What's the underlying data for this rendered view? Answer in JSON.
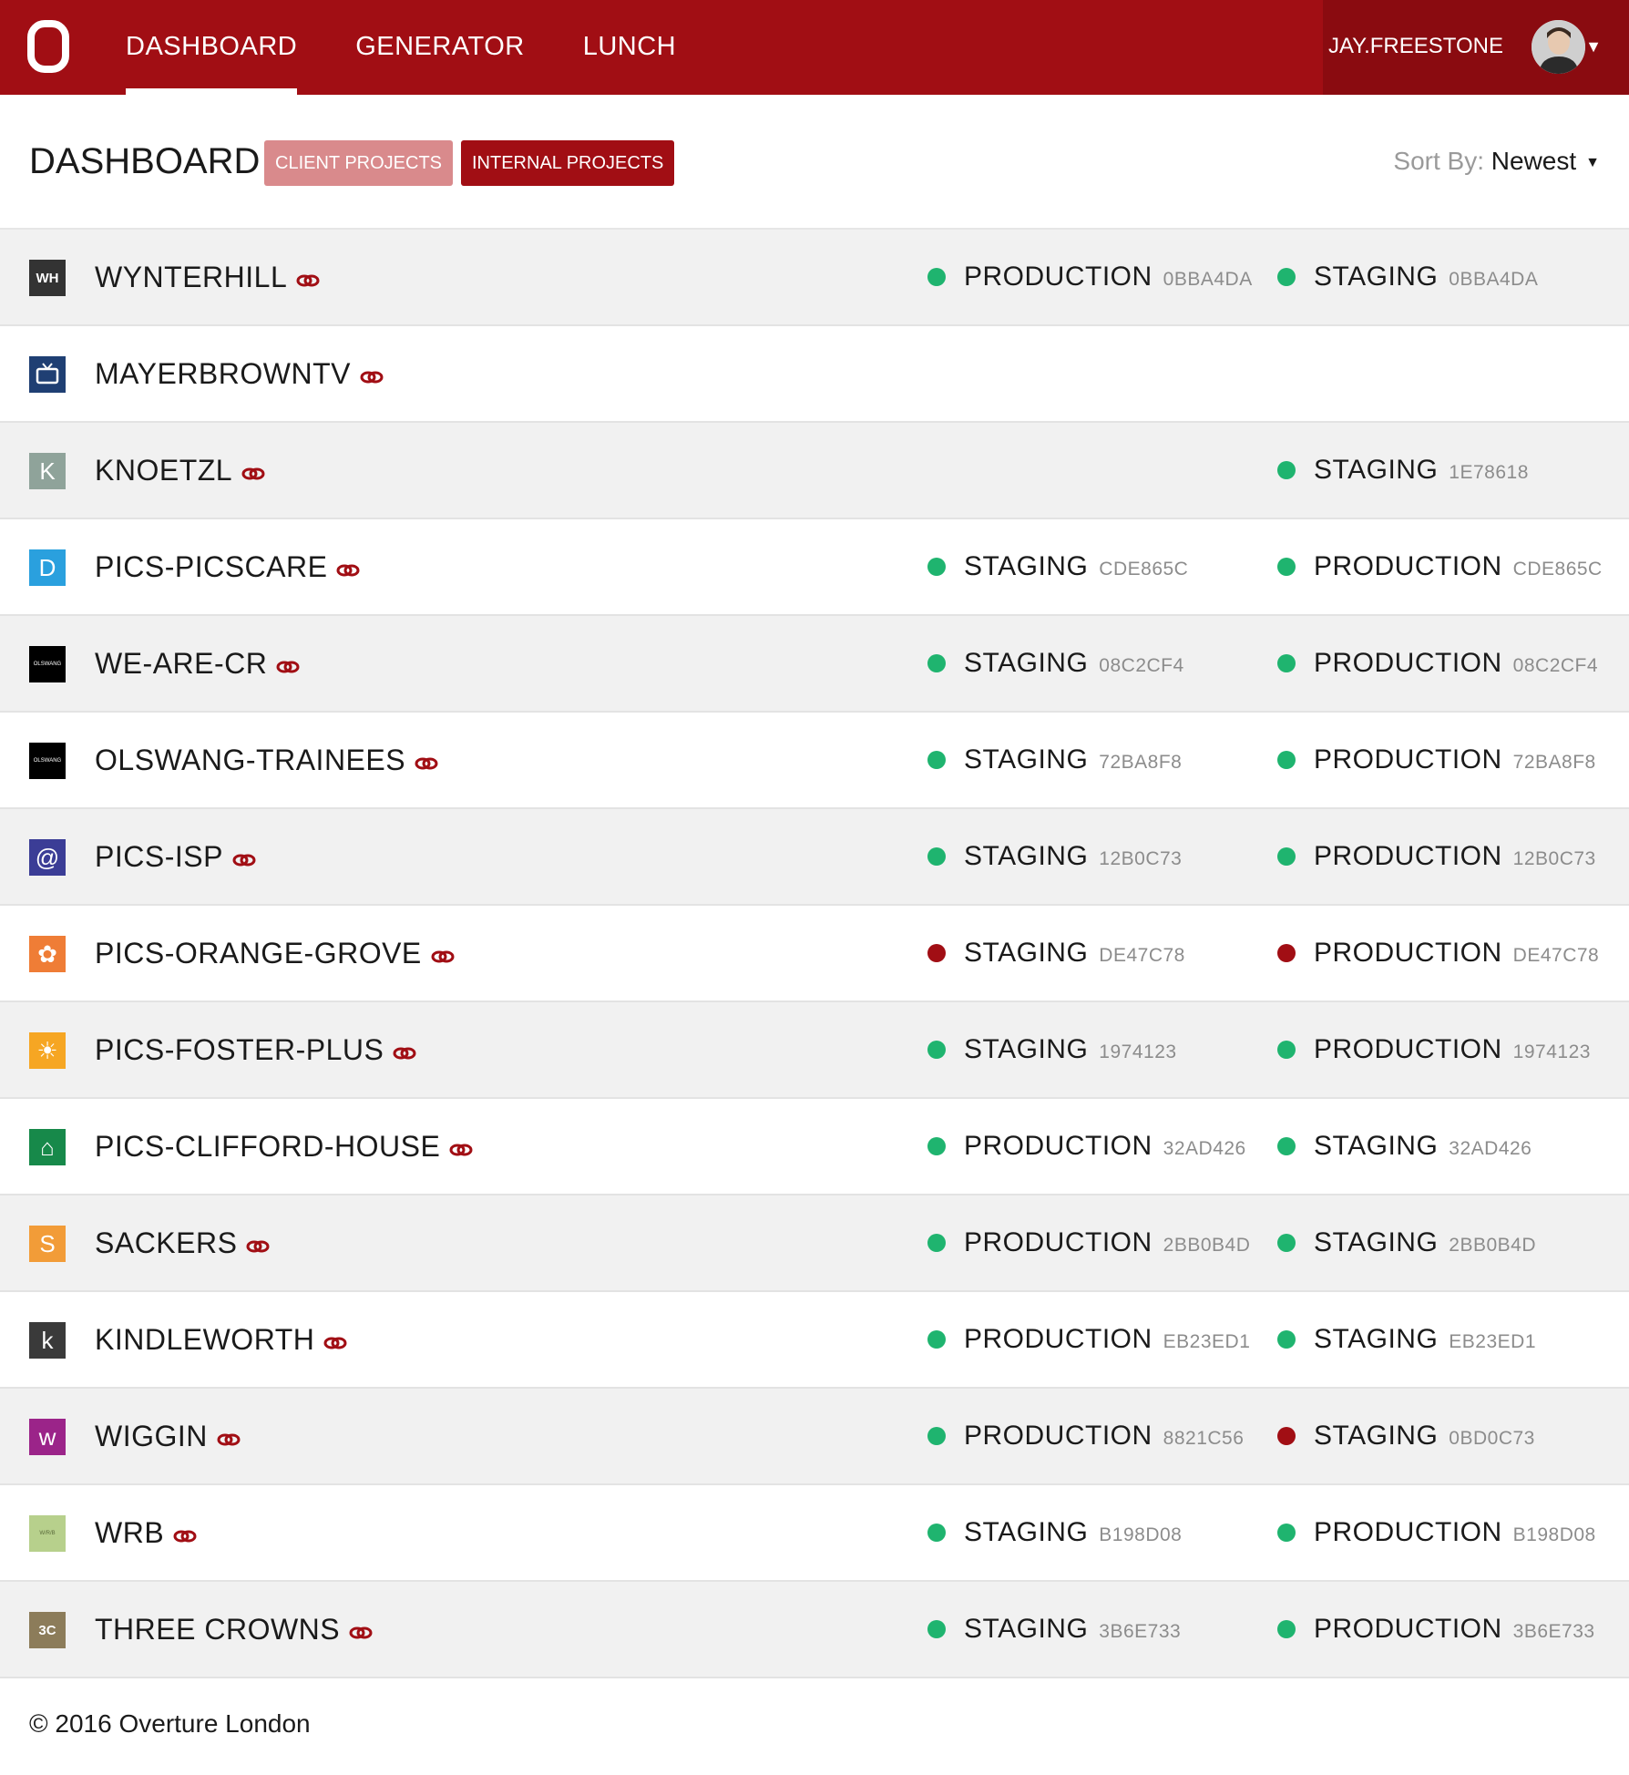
{
  "nav": {
    "logo": "O",
    "items": [
      {
        "label": "DASHBOARD",
        "active": true
      },
      {
        "label": "GENERATOR",
        "active": false
      },
      {
        "label": "LUNCH",
        "active": false
      }
    ]
  },
  "user": {
    "name": "JAY.FREESTONE",
    "caret": "▼"
  },
  "header": {
    "title": "DASHBOARD",
    "filters": {
      "client": "CLIENT PROJECTS",
      "internal": "INTERNAL PROJECTS"
    },
    "sort_label": "Sort By:",
    "sort_value": "Newest",
    "sort_caret": "▼"
  },
  "colors": {
    "brand": "#a10e14",
    "ok": "#1fb46f",
    "fail": "#a10e14"
  },
  "projects": [
    {
      "name": "WYNTERHILL",
      "icon": "wynterhill-logo-icon",
      "icon_text": "WH",
      "icon_bg": "#333333",
      "icon_fg": "#ffffff",
      "envs": [
        {
          "label": "PRODUCTION",
          "hash": "0BBA4DA",
          "status": "ok"
        },
        {
          "label": "STAGING",
          "hash": "0BBA4DA",
          "status": "ok"
        }
      ]
    },
    {
      "name": "MAYERBROWNTV",
      "icon": "tv-icon",
      "icon_text": "",
      "icon_bg": "#1f3f73",
      "icon_fg": "#ffffff",
      "envs": []
    },
    {
      "name": "KNOETZL",
      "icon": "knoetzl-logo-icon",
      "icon_text": "K",
      "icon_bg": "#8fa39a",
      "icon_fg": "#ffffff",
      "envs": [
        null,
        {
          "label": "STAGING",
          "hash": "1E78618",
          "status": "ok"
        }
      ]
    },
    {
      "name": "PICS-PICSCARE",
      "icon": "picscare-logo-icon",
      "icon_text": "D",
      "icon_bg": "#2aa0de",
      "icon_fg": "#ffffff",
      "envs": [
        {
          "label": "STAGING",
          "hash": "CDE865C",
          "status": "ok"
        },
        {
          "label": "PRODUCTION",
          "hash": "CDE865C",
          "status": "ok"
        }
      ]
    },
    {
      "name": "WE-ARE-CR",
      "icon": "olswang-logo-icon",
      "icon_text": "OLSWANG",
      "icon_bg": "#000000",
      "icon_fg": "#ffffff",
      "envs": [
        {
          "label": "STAGING",
          "hash": "08C2CF4",
          "status": "ok"
        },
        {
          "label": "PRODUCTION",
          "hash": "08C2CF4",
          "status": "ok"
        }
      ]
    },
    {
      "name": "OLSWANG-TRAINEES",
      "icon": "olswang-logo-icon",
      "icon_text": "OLSWANG",
      "icon_bg": "#000000",
      "icon_fg": "#ffffff",
      "envs": [
        {
          "label": "STAGING",
          "hash": "72BA8F8",
          "status": "ok"
        },
        {
          "label": "PRODUCTION",
          "hash": "72BA8F8",
          "status": "ok"
        }
      ]
    },
    {
      "name": "PICS-ISP",
      "icon": "spiral-logo-icon",
      "icon_text": "@",
      "icon_bg": "#3b3d96",
      "icon_fg": "#ffffff",
      "envs": [
        {
          "label": "STAGING",
          "hash": "12B0C73",
          "status": "ok"
        },
        {
          "label": "PRODUCTION",
          "hash": "12B0C73",
          "status": "ok"
        }
      ]
    },
    {
      "name": "PICS-ORANGE-GROVE",
      "icon": "tree-logo-icon",
      "icon_text": "✿",
      "icon_bg": "#ef7d36",
      "icon_fg": "#ffffff",
      "envs": [
        {
          "label": "STAGING",
          "hash": "DE47C78",
          "status": "fail"
        },
        {
          "label": "PRODUCTION",
          "hash": "DE47C78",
          "status": "fail"
        }
      ]
    },
    {
      "name": "PICS-FOSTER-PLUS",
      "icon": "sun-logo-icon",
      "icon_text": "☀",
      "icon_bg": "#f6a623",
      "icon_fg": "#ffffff",
      "envs": [
        {
          "label": "STAGING",
          "hash": "1974123",
          "status": "ok"
        },
        {
          "label": "PRODUCTION",
          "hash": "1974123",
          "status": "ok"
        }
      ]
    },
    {
      "name": "PICS-CLIFFORD-HOUSE",
      "icon": "house-logo-icon",
      "icon_text": "⌂",
      "icon_bg": "#17894a",
      "icon_fg": "#ffffff",
      "envs": [
        {
          "label": "PRODUCTION",
          "hash": "32AD426",
          "status": "ok"
        },
        {
          "label": "STAGING",
          "hash": "32AD426",
          "status": "ok"
        }
      ]
    },
    {
      "name": "SACKERS",
      "icon": "sackers-logo-icon",
      "icon_text": "S",
      "icon_bg": "#f29c38",
      "icon_fg": "#ffffff",
      "envs": [
        {
          "label": "PRODUCTION",
          "hash": "2BB0B4D",
          "status": "ok"
        },
        {
          "label": "STAGING",
          "hash": "2BB0B4D",
          "status": "ok"
        }
      ]
    },
    {
      "name": "KINDLEWORTH",
      "icon": "kindleworth-logo-icon",
      "icon_text": "k",
      "icon_bg": "#3a3a3a",
      "icon_fg": "#ffffff",
      "envs": [
        {
          "label": "PRODUCTION",
          "hash": "EB23ED1",
          "status": "ok"
        },
        {
          "label": "STAGING",
          "hash": "EB23ED1",
          "status": "ok"
        }
      ]
    },
    {
      "name": "WIGGIN",
      "icon": "wiggin-logo-icon",
      "icon_text": "w",
      "icon_bg": "#9b2489",
      "icon_fg": "#ffffff",
      "envs": [
        {
          "label": "PRODUCTION",
          "hash": "8821C56",
          "status": "ok"
        },
        {
          "label": "STAGING",
          "hash": "0BD0C73",
          "status": "fail"
        }
      ]
    },
    {
      "name": "WRB",
      "icon": "wrb-logo-icon",
      "icon_text": "W/R/B",
      "icon_bg": "#b7d08c",
      "icon_fg": "#5a6a3a",
      "envs": [
        {
          "label": "STAGING",
          "hash": "B198D08",
          "status": "ok"
        },
        {
          "label": "PRODUCTION",
          "hash": "B198D08",
          "status": "ok"
        }
      ]
    },
    {
      "name": "THREE CROWNS",
      "icon": "three-crowns-logo-icon",
      "icon_text": "3C",
      "icon_bg": "#8c7c5a",
      "icon_fg": "#ffffff",
      "envs": [
        {
          "label": "STAGING",
          "hash": "3B6E733",
          "status": "ok"
        },
        {
          "label": "PRODUCTION",
          "hash": "3B6E733",
          "status": "ok"
        }
      ]
    }
  ],
  "footer": {
    "text": "© 2016 Overture London"
  }
}
